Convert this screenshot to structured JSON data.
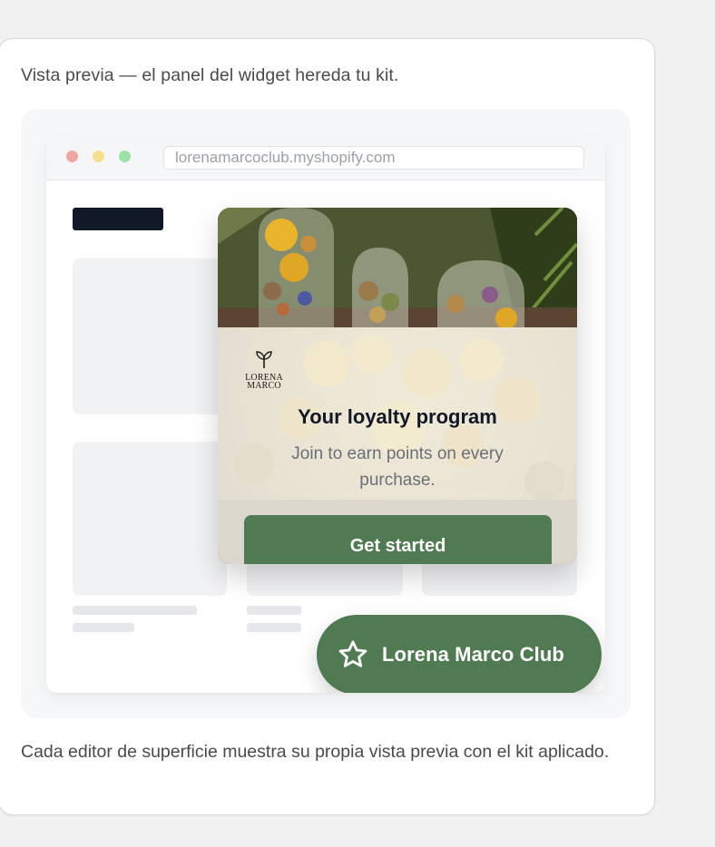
{
  "caption_top": "Vista previa — el panel del widget hereda tu kit.",
  "caption_bottom": "Cada editor de superficie muestra su propia vista previa con el kit aplicado.",
  "browser": {
    "url": "lorenamarcoclub.myshopify.com"
  },
  "widget": {
    "brand_logo_lines": [
      "LORENA",
      "MARCO"
    ],
    "title": "Your loyalty program",
    "subtitle": "Join to earn points on every purchase.",
    "cta_label": "Get started",
    "hero_image": "dried-flower-glass-domes-photo"
  },
  "launcher": {
    "icon": "star-icon",
    "label": "Lorena Marco Club"
  },
  "colors": {
    "accent": "#4f7a52",
    "title_text": "#111827",
    "muted_text": "#6b6f78"
  }
}
